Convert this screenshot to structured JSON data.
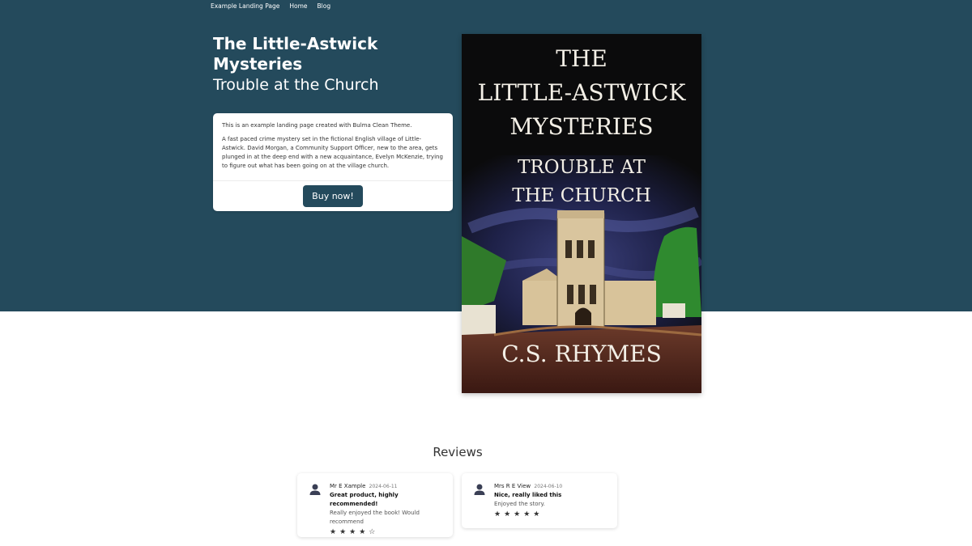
{
  "nav": {
    "brand": "Example Landing Page",
    "links": [
      "Home",
      "Blog"
    ]
  },
  "hero": {
    "title": "The Little-Astwick Mysteries",
    "subtitle": "Trouble at the Church",
    "intro": "This is an example landing page created with Bulma Clean Theme.",
    "description": "A fast paced crime mystery set in the fictional English village of Little-Astwick. David Morgan, a Community Support Officer, new to the area, gets plunged in at the deep end with a new acquaintance, Evelyn McKenzie, trying to figure out what has been going on at the village church.",
    "buy_label": "Buy now!"
  },
  "cover": {
    "line1": "THE",
    "line2": "LITTLE-ASTWICK",
    "line3": "MYSTERIES",
    "line4": "TROUBLE AT",
    "line5": "THE CHURCH",
    "author": "C.S. RHYMES"
  },
  "reviews": {
    "title": "Reviews",
    "items": [
      {
        "name": "Mr E Xample",
        "date": "2024-06-11",
        "headline": "Great product, highly recommended!",
        "text": "Really enjoyed the book! Would recommend",
        "rating": 4,
        "stars": "★★★★☆"
      },
      {
        "name": "Mrs R E View",
        "date": "2024-06-10",
        "headline": "Nice, really liked this",
        "text": "Enjoyed the story.",
        "rating": 5,
        "stars": "★★★★★"
      }
    ]
  },
  "colors": {
    "hero_bg": "#244a5c",
    "button_bg": "#244a5c"
  },
  "icons": {
    "avatar": "user-icon",
    "star_full": "star-icon",
    "star_empty": "star-outline-icon"
  }
}
